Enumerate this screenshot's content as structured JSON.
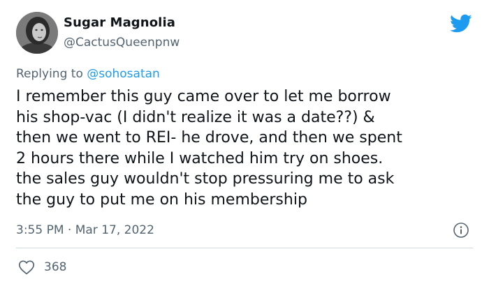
{
  "tweet": {
    "author": {
      "display_name": "Sugar Magnolia",
      "handle": "@CactusQueenpnw"
    },
    "reply": {
      "prefix": "Replying to ",
      "mention": "@sohosatan"
    },
    "text_lines": [
      "I remember this guy came over to let me borrow",
      "his shop-vac (I didn't realize it was a date??) &",
      "then we went to REI- he drove, and then we spent",
      "2 hours there while I watched him try on shoes.",
      "the sales guy wouldn't stop pressuring me to ask",
      "the guy to put me on his membership"
    ],
    "timestamp": "3:55 PM · Mar 17, 2022",
    "like_count": "368"
  },
  "icons": {
    "brand": "twitter-bird-icon",
    "info": "info-icon",
    "like": "heart-icon"
  },
  "colors": {
    "brand_blue": "#1d9bf0",
    "text_primary": "#0f1419",
    "text_secondary": "#536471",
    "divider": "#cfd9de"
  }
}
